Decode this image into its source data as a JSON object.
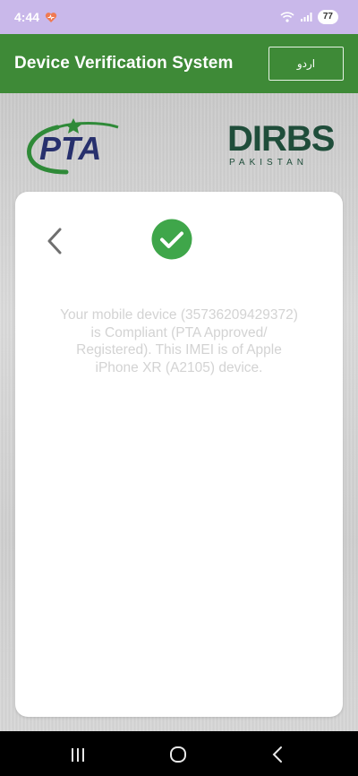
{
  "status": {
    "time": "4:44",
    "battery": "77",
    "icons": [
      "heart-icon",
      "wifi-icon",
      "signal-icon",
      "battery-icon"
    ]
  },
  "header": {
    "title": "Device Verification System",
    "language_button": "اردو"
  },
  "logos": {
    "pta": "PTA",
    "dirbs": "DIRBS",
    "dirbs_sub": "PAKISTAN"
  },
  "card": {
    "message": "Your mobile device (35736209429372) is Compliant (PTA Approved/ Registered). This IMEI is of Apple iPhone XR (A2105) device."
  },
  "colors": {
    "status_bar": "#c9b8ea",
    "app_bar": "#3e8a37",
    "check": "#3fa64a",
    "message_text": "#d3d3d3"
  },
  "navigation": [
    "recent-apps-icon",
    "home-icon",
    "back-icon"
  ]
}
